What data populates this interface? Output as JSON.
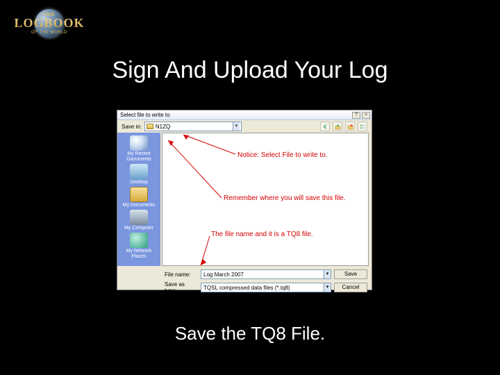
{
  "logo": {
    "the": "THE",
    "main": "LOGBOOK",
    "sub": "OF THE WORLD"
  },
  "slide": {
    "title": "Sign And Upload Your Log",
    "caption": "Save the TQ8 File."
  },
  "dialog": {
    "title": "Select file to write to",
    "help_btn": "?",
    "close_btn": "×",
    "savein_label": "Save in:",
    "savein_value": "N1ZQ",
    "places": {
      "recent": "My Recent Documents",
      "desktop": "Desktop",
      "mydocs": "My Documents",
      "mycomputer": "My Computer",
      "network": "My Network Places"
    },
    "filename_label": "File name:",
    "filename_value": "Log March 2007",
    "saveas_label": "Save as type:",
    "saveas_value": "TQSL compressed data files (*.tq8)",
    "save_btn": "Save",
    "cancel_btn": "Cancel"
  },
  "annotations": {
    "a": "Notice: Select File to write to.",
    "b": "Remember where you will save this file.",
    "c": "The file name and it is a TQ8 file."
  }
}
